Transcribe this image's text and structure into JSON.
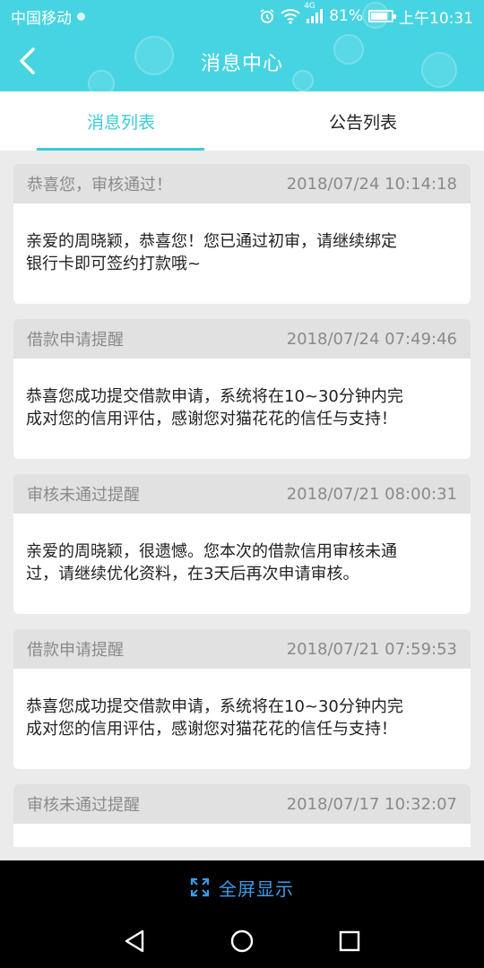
{
  "status_bar": {
    "carrier": "中国移动",
    "network": "4G",
    "battery": "81%",
    "battery_level": 0.81,
    "time": "上午10:31"
  },
  "header": {
    "title": "消息中心"
  },
  "tabs": [
    {
      "label": "消息列表",
      "active": true
    },
    {
      "label": "公告列表",
      "active": false
    }
  ],
  "messages": [
    {
      "title": "恭喜您，审核通过！",
      "time": "2018/07/24 10:14:18",
      "body_line1": "亲爱的周晓颖，恭喜您！您已通过初审，请继续绑定",
      "body_line2": "银行卡即可签约打款哦~"
    },
    {
      "title": "借款申请提醒",
      "time": "2018/07/24 07:49:46",
      "body_line1": "恭喜您成功提交借款申请，系统将在10~30分钟内完",
      "body_line2": "成对您的信用评估，感谢您对猫花花的信任与支持！"
    },
    {
      "title": "审核未通过提醒",
      "time": "2018/07/21 08:00:31",
      "body_line1": "亲爱的周晓颖，很遗憾。您本次的借款信用审核未通",
      "body_line2": "过，请继续优化资料，在3天后再次申请审核。"
    },
    {
      "title": "借款申请提醒",
      "time": "2018/07/21 07:59:53",
      "body_line1": "恭喜您成功提交借款申请，系统将在10~30分钟内完",
      "body_line2": "成对您的信用评估，感谢您对猫花花的信任与支持！"
    },
    {
      "title": "审核未通过提醒",
      "time": "2018/07/17 10:32:07",
      "body_line1": "",
      "body_line2": ""
    }
  ],
  "fullscreen": {
    "label": "全屏显示",
    "icon": "expand-icon"
  },
  "system_nav": {
    "icons": [
      "back-triangle-icon",
      "home-circle-icon",
      "recents-square-icon"
    ]
  },
  "colors": {
    "accent": "#47d4e2",
    "tab_active": "#3ccbd9",
    "fullscreen_text": "#3d9be9"
  }
}
